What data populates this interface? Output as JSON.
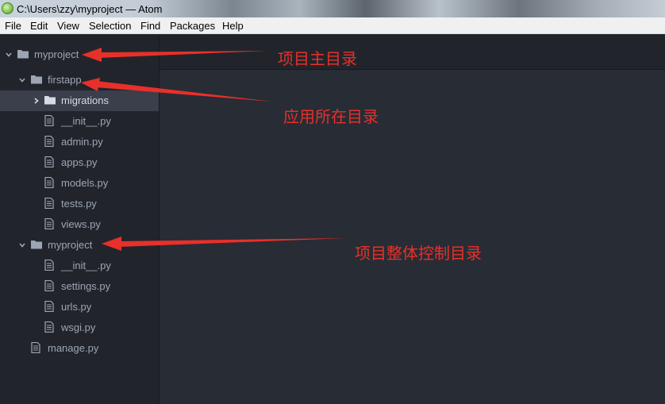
{
  "window": {
    "title": "C:\\Users\\zzy\\myproject — Atom",
    "app_icon": "atom-icon"
  },
  "menu": {
    "items": [
      "File",
      "Edit",
      "View",
      "Selection",
      "Find",
      "Packages",
      "Help"
    ]
  },
  "tree": {
    "items": [
      {
        "label": "myproject",
        "type": "folder",
        "expanded": true
      },
      {
        "label": "firstapp",
        "type": "folder",
        "expanded": true
      },
      {
        "label": "migrations",
        "type": "folder",
        "expanded": false,
        "selected": true
      },
      {
        "label": "__init__.py",
        "type": "file"
      },
      {
        "label": "admin.py",
        "type": "file"
      },
      {
        "label": "apps.py",
        "type": "file"
      },
      {
        "label": "models.py",
        "type": "file"
      },
      {
        "label": "tests.py",
        "type": "file"
      },
      {
        "label": "views.py",
        "type": "file"
      },
      {
        "label": "myproject",
        "type": "folder",
        "expanded": true
      },
      {
        "label": "__init__.py",
        "type": "file"
      },
      {
        "label": "settings.py",
        "type": "file"
      },
      {
        "label": "urls.py",
        "type": "file"
      },
      {
        "label": "wsgi.py",
        "type": "file"
      },
      {
        "label": "manage.py",
        "type": "file"
      }
    ]
  },
  "annotations": [
    {
      "text": "项目主目录"
    },
    {
      "text": "应用所在目录"
    },
    {
      "text": "项目整体控制目录"
    }
  ],
  "colors": {
    "annotation": "#e8302a",
    "tree_background": "#21252b",
    "editor_background": "#282c34",
    "selected_row": "#3a3f4b"
  }
}
